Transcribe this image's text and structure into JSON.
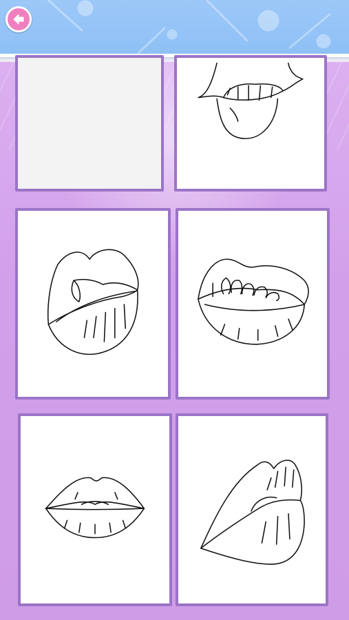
{
  "app": {
    "screen": "coloring-page-picker",
    "accent_header": "#9cc8f8",
    "accent_background": "#d7a6ee",
    "card_border": "#9b74c6",
    "back_button_color": "#f07fc0"
  },
  "header": {
    "back_button": {
      "icon": "arrow-left-icon"
    }
  },
  "grid": {
    "columns": 2,
    "items": [
      {
        "kind": "blank",
        "icon": "blank-page"
      },
      {
        "kind": "drawing",
        "icon": "lips-teeth-bite-icon"
      },
      {
        "kind": "drawing",
        "icon": "lips-side-open-icon"
      },
      {
        "kind": "drawing",
        "icon": "lips-smile-teeth-icon"
      },
      {
        "kind": "drawing",
        "icon": "lips-closed-front-icon"
      },
      {
        "kind": "drawing",
        "icon": "lips-side-pout-icon"
      }
    ]
  }
}
